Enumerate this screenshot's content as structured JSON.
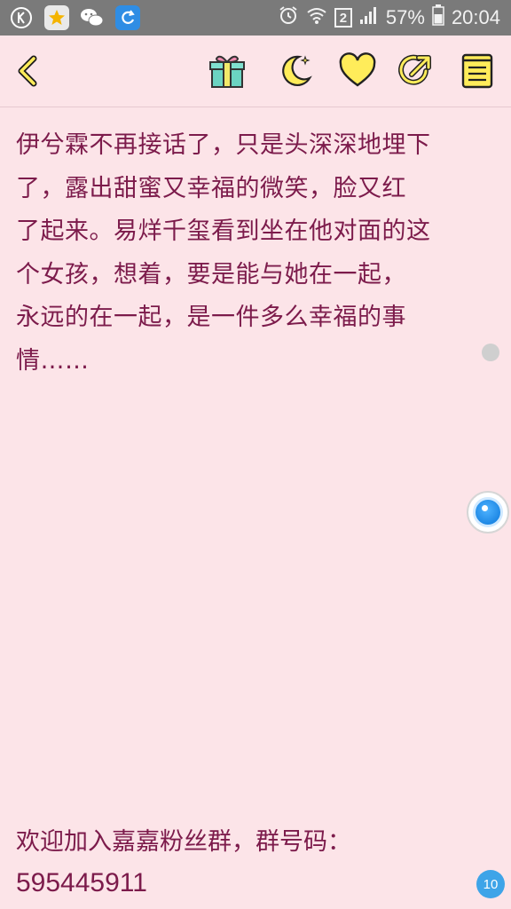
{
  "status_bar": {
    "battery_percent": "57%",
    "time": "20:04",
    "sim_label": "2",
    "left_icons": [
      "k-app-icon",
      "star-app-icon",
      "wechat-icon",
      "sync-app-icon"
    ]
  },
  "toolbar": {
    "back_icon": "chevron-left-icon",
    "icons": [
      "gift-icon",
      "moon-icon",
      "heart-icon",
      "share-icon",
      "notebook-icon"
    ]
  },
  "content": {
    "paragraph_lines": [
      "伊兮霖不再接话了，只是头深深地埋下",
      "了，露出甜蜜又幸福的微笑，脸又红",
      "了起来。易烊千玺看到坐在他对面的这",
      "个女孩，想着，要是能与她在一起，",
      "永远的在一起，是一件多么幸福的事",
      "情……"
    ]
  },
  "footer": {
    "line1": "欢迎加入嘉嘉粉丝群，群号码：",
    "line2": "595445911"
  },
  "page_badge": "10",
  "colors": {
    "background": "#fce4e8",
    "text": "#7c1b4b",
    "status_bar": "#7a7a7a",
    "accent_yellow": "#ffec5a",
    "badge": "#3ea4e8"
  }
}
